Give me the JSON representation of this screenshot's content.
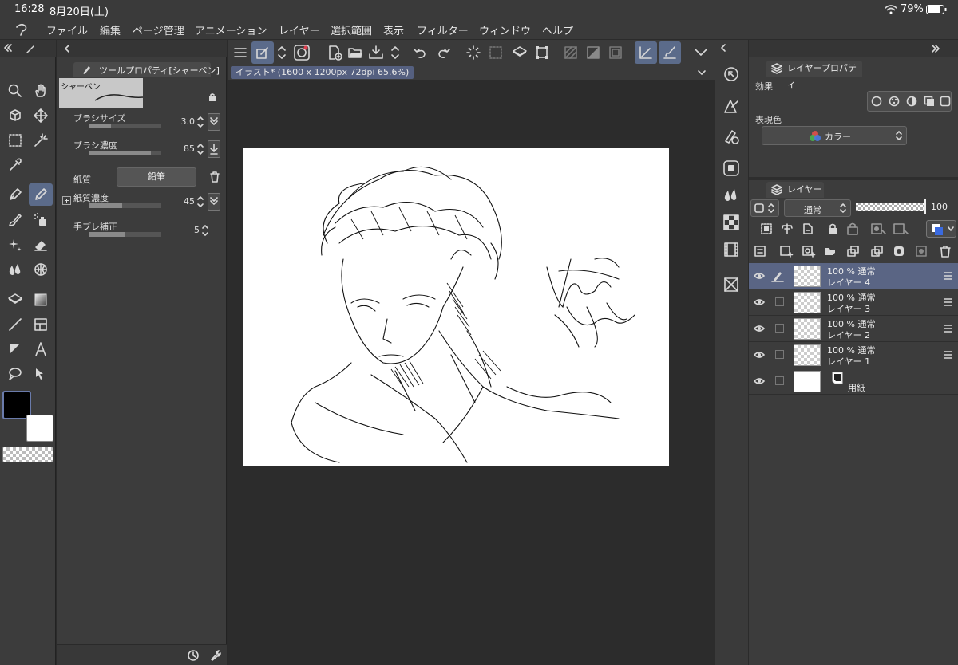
{
  "status": {
    "time": "16:28",
    "date": "8月20日(土)",
    "battery": "79%"
  },
  "menu": [
    "ファイル",
    "編集",
    "ページ管理",
    "アニメーション",
    "レイヤー",
    "選択範囲",
    "表示",
    "フィルター",
    "ウィンドウ",
    "ヘルプ"
  ],
  "toolbox": {
    "tools": [
      "zoom-icon",
      "hand-icon",
      "object-icon",
      "move-icon",
      "marquee-icon",
      "magic-wand-icon",
      "eyedropper-icon",
      "pen-icon",
      "pencil-icon",
      "brush-icon",
      "airbrush-icon",
      "decoration-icon",
      "eraser-icon",
      "blend-icon",
      "grid-icon",
      "fill-icon",
      "gradient-icon",
      "line-icon",
      "frame-icon",
      "balloon-icon",
      "text-icon",
      "speech-icon",
      "correction-icon"
    ],
    "active_tool": "pencil-icon",
    "main_color": "#000000",
    "sub_color": "#ffffff"
  },
  "tool_property": {
    "tab_label": "ツールプロパティ[シャーペン]",
    "brush_name": "シャーペン",
    "rows": [
      {
        "label": "ブラシサイズ",
        "value": "3.0",
        "level": 0.3
      },
      {
        "label": "ブラシ濃度",
        "value": "85",
        "level": 0.85
      },
      {
        "label": "紙質",
        "button": "鉛筆"
      },
      {
        "label": "紙質濃度",
        "value": "45",
        "level": 0.45
      },
      {
        "label": "手ブレ補正",
        "value": "5",
        "level": 0.5
      }
    ]
  },
  "canvas": {
    "doc_tab": "イラスト* (1600 x 1200px 72dpi 65.6%)"
  },
  "layer_property": {
    "tab_label": "レイヤープロパティ",
    "effect_label": "効果",
    "color_label": "表現色",
    "color_value": "カラー"
  },
  "layers_panel": {
    "tab_label": "レイヤー",
    "blend_mode": "通常",
    "opacity": "100",
    "layers": [
      {
        "line1": "100 % 通常",
        "line2": "レイヤー 4",
        "selected": true,
        "paper": false
      },
      {
        "line1": "100 % 通常",
        "line2": "レイヤー 3",
        "selected": false,
        "paper": false
      },
      {
        "line1": "100 % 通常",
        "line2": "レイヤー 2",
        "selected": false,
        "paper": false
      },
      {
        "line1": "100 % 通常",
        "line2": "レイヤー 1",
        "selected": false,
        "paper": false
      },
      {
        "line1": "",
        "line2": "用紙",
        "selected": false,
        "paper": true
      }
    ]
  },
  "colors": {
    "accent": "#5b6b8a",
    "panel": "#3c3c3c",
    "selected_layer": "#5a6584"
  }
}
